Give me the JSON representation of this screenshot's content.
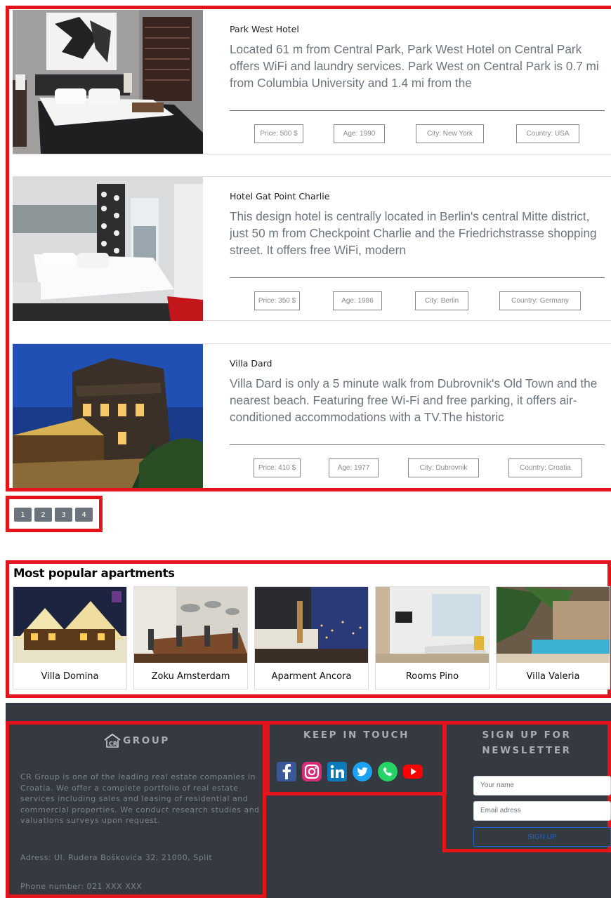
{
  "hotels": [
    {
      "name": "Park West Hotel",
      "description": "Located 61 m from Central Park, Park West Hotel on Central Park offers WiFi and laundry services. Park West on Central Park is 0.7 mi from Columbia University and 1.4 mi from the",
      "price": "Price: 500 $",
      "age": "Age: 1990",
      "city": "City: New York",
      "country": "Country: USA"
    },
    {
      "name": "Hotel Gat Point Charlie",
      "description": "This design hotel is centrally located in Berlin's central Mitte district, just 50 m from Checkpoint Charlie and the Friedrichstrasse shopping street. It offers free WiFi, modern",
      "price": "Price: 350 $",
      "age": "Age: 1986",
      "city": "City: Berlin",
      "country": "Country: Germany"
    },
    {
      "name": "Villa Dard",
      "description": "Villa Dard is only a 5 minute walk from Dubrovnik's Old Town and the nearest beach. Featuring free Wi-Fi and free parking, it offers air-conditioned accommodations with a TV.The historic",
      "price": "Price: 410 $",
      "age": "Age: 1977",
      "city": "City: Dubrovnik",
      "country": "Country: Croatia"
    }
  ],
  "pagination": [
    "1",
    "2",
    "3",
    "4"
  ],
  "popular": {
    "title": "Most popular apartments",
    "items": [
      "Villa Domina",
      "Zoku Amsterdam",
      "Aparment Ancora",
      "Rooms Pino",
      "Villa Valeria"
    ]
  },
  "footer": {
    "group": {
      "title": "GROUP",
      "about": "CR Group is one of the leading real estate companies in Croatia. We offer a complete portfolio of real estate services including sales and leasing of residential and commercial properties. We conduct research studies and valuations surveys upon request.",
      "address": "Adress: Ul. Rudera Boškovića 32, 21000, Split",
      "phone": "Phone number: 021 XXX XXX"
    },
    "touch": {
      "title": "KEEP IN TOUCH",
      "icons": [
        "facebook-icon",
        "instagram-icon",
        "linkedin-icon",
        "twitter-icon",
        "whatsapp-icon",
        "youtube-icon"
      ]
    },
    "newsletter": {
      "title": "SIGN UP FOR NEWSLETTER",
      "name_placeholder": "Your name",
      "email_placeholder": "Email adress",
      "button": "SIGN UP"
    }
  },
  "colors": {
    "highlight": "#e4141c",
    "footer_bg": "#343a40",
    "pager_bg": "#6c757d",
    "signup_accent": "#1a64c8"
  }
}
